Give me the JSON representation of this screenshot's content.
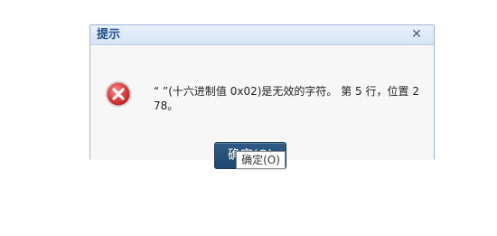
{
  "dialog": {
    "title": "提示",
    "close_icon": "✕",
    "icon": "error-icon",
    "message": "“ ”(十六进制值 0x02)是无效的字符。 第 5 行，位置 278。",
    "button_label": "确定(O)"
  },
  "tooltip": {
    "text": "确定(O)"
  },
  "colors": {
    "title": "#1f4f8f",
    "button": "#2f5b86",
    "error": "#d83a3a"
  }
}
